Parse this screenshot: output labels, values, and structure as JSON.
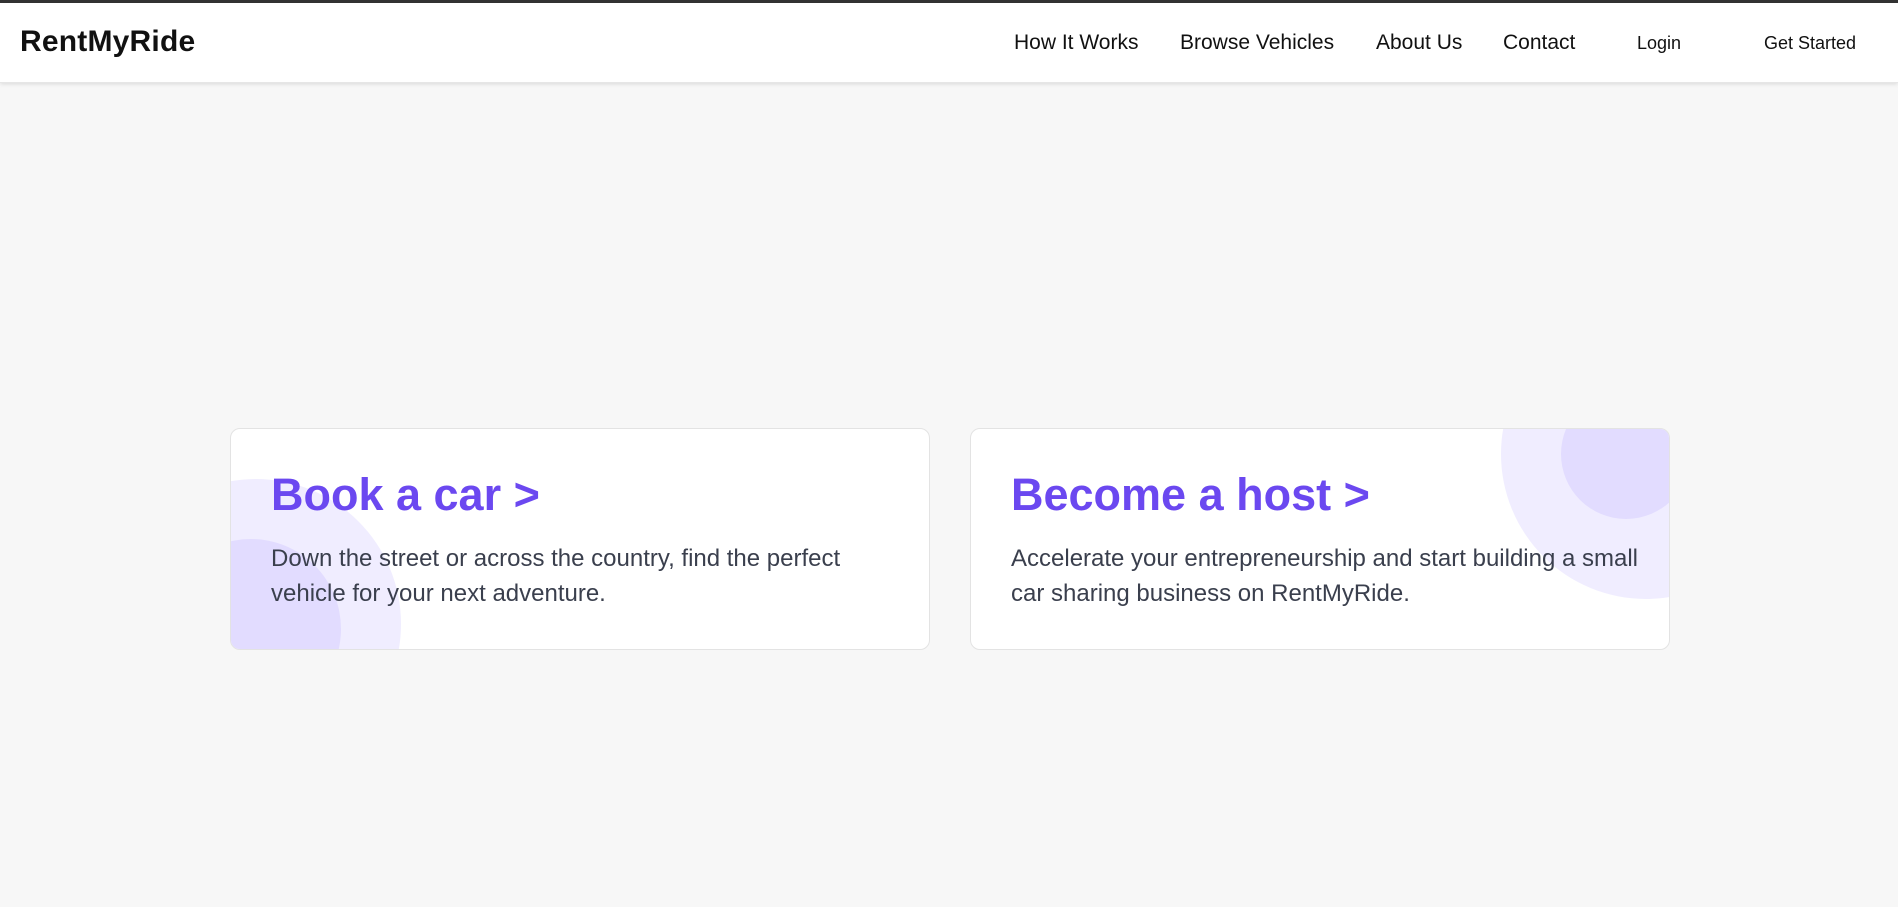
{
  "header": {
    "logo": "RentMyRide",
    "nav": [
      {
        "label": "How It Works"
      },
      {
        "label": "Browse Vehicles"
      },
      {
        "label": "About Us"
      },
      {
        "label": "Contact"
      }
    ],
    "login_label": "Login",
    "get_started_label": "Get Started"
  },
  "cards": [
    {
      "title": "Book a car >",
      "description": "Down the street or across the country, find the perfect vehicle for your next adventure."
    },
    {
      "title": "Become a host >",
      "description": "Accelerate your entrepreneurship and start building a small car sharing business on RentMyRide."
    }
  ],
  "colors": {
    "accent": "#6b48f0",
    "deco_light": "#f0edff",
    "deco_mid": "#e2dcff",
    "background": "#f7f7f7"
  }
}
